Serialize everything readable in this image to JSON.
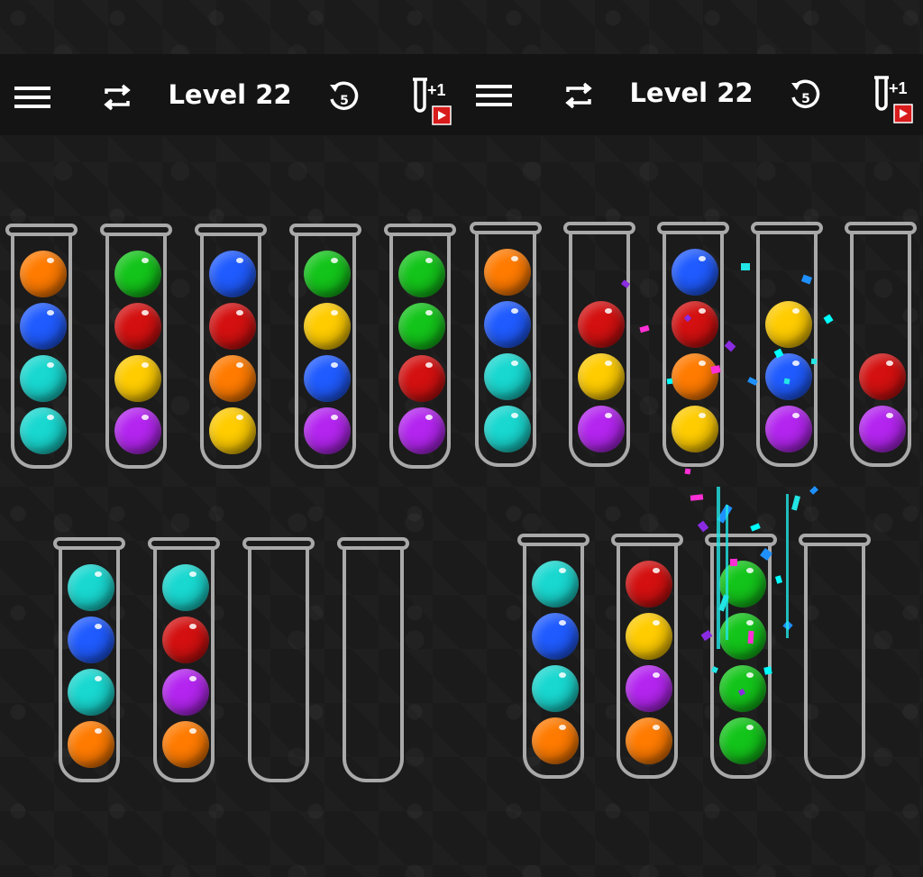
{
  "level_label": "Level 22",
  "extra_tube_label": "+1",
  "colors": {
    "orange": "#ff7b00",
    "blue": "#1f5bff",
    "cyan": "#18d8d0",
    "green": "#13c51a",
    "red": "#d41010",
    "yellow": "#ffcc00",
    "purple": "#b425f0",
    "ad_badge": "#d81b1b"
  },
  "panels": [
    {
      "name": "before",
      "tubes": [
        [
          "orange",
          "blue",
          "cyan",
          "cyan"
        ],
        [
          "green",
          "red",
          "yellow",
          "purple"
        ],
        [
          "blue",
          "red",
          "orange",
          "yellow"
        ],
        [
          "green",
          "yellow",
          "blue",
          "purple"
        ],
        [
          "green",
          "green",
          "red",
          "purple"
        ],
        [
          "cyan",
          "blue",
          "cyan",
          "orange"
        ],
        [
          "cyan",
          "red",
          "purple",
          "orange"
        ],
        [],
        []
      ]
    },
    {
      "name": "after",
      "tubes": [
        [
          "orange",
          "blue",
          "cyan",
          "cyan"
        ],
        [
          "red",
          "yellow",
          "purple"
        ],
        [
          "blue",
          "red",
          "orange",
          "yellow"
        ],
        [
          "yellow",
          "blue",
          "purple"
        ],
        [
          "red",
          "purple"
        ],
        [
          "cyan",
          "blue",
          "cyan",
          "orange"
        ],
        [
          "red",
          "yellow",
          "purple",
          "orange"
        ],
        [
          "green",
          "green",
          "green",
          "green"
        ],
        []
      ]
    }
  ]
}
